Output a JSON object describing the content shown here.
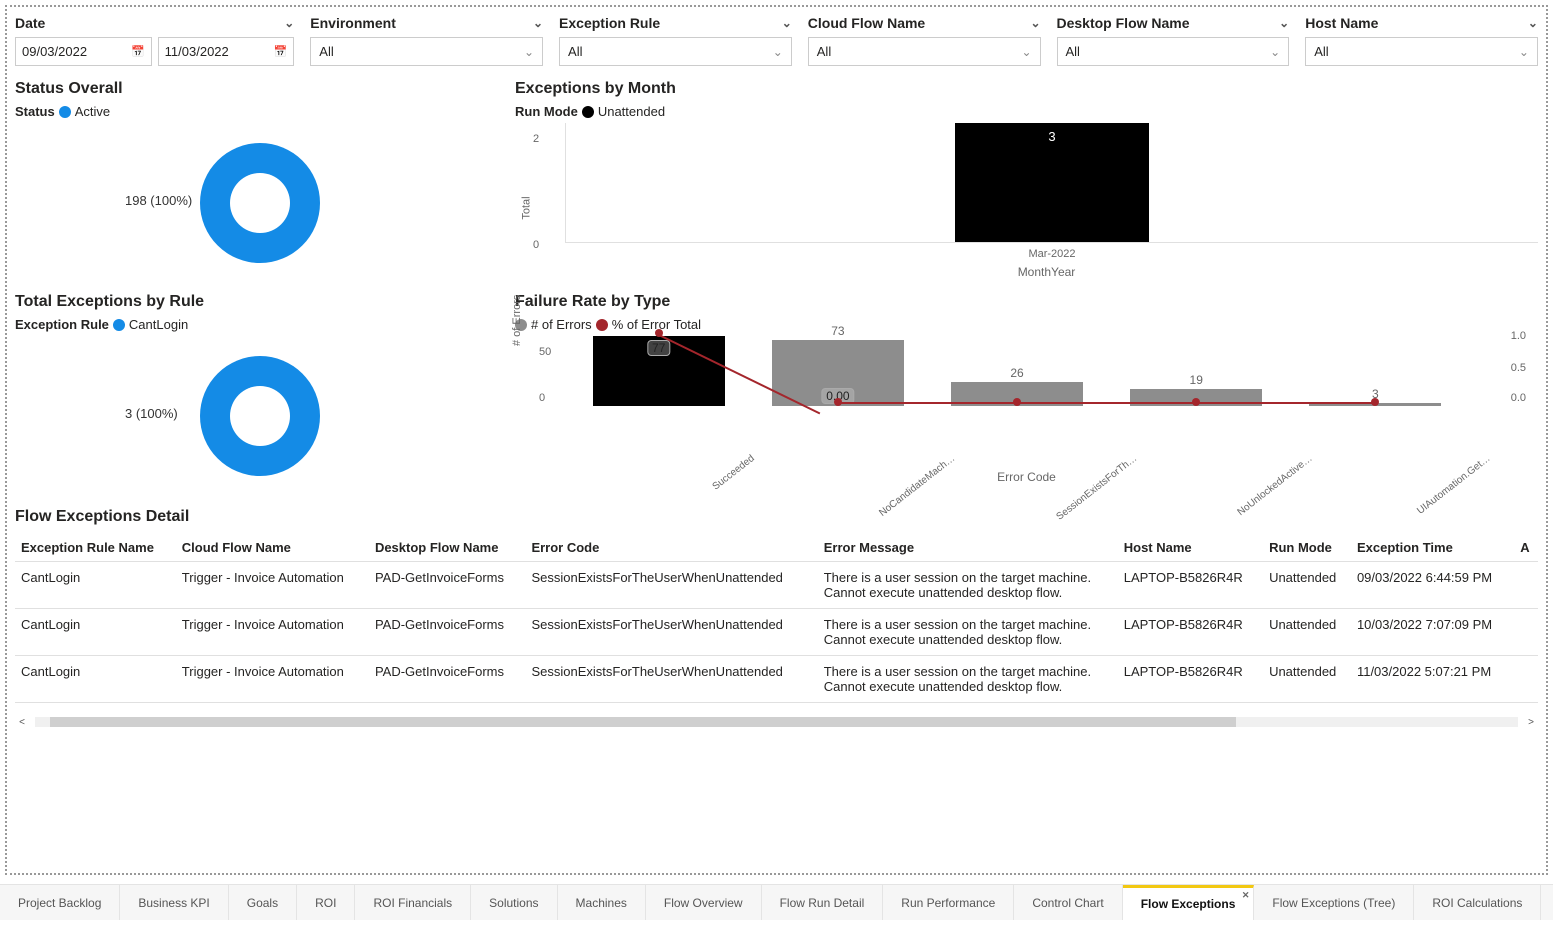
{
  "filters": {
    "date_label": "Date",
    "date_from": "09/03/2022",
    "date_to": "11/03/2022",
    "environment_label": "Environment",
    "environment_value": "All",
    "exception_rule_label": "Exception Rule",
    "exception_rule_value": "All",
    "cloud_flow_label": "Cloud Flow Name",
    "cloud_flow_value": "All",
    "desktop_flow_label": "Desktop Flow Name",
    "desktop_flow_value": "All",
    "host_name_label": "Host Name",
    "host_name_value": "All"
  },
  "status_overall": {
    "title": "Status Overall",
    "legend_label": "Status",
    "legend_item": "Active",
    "label": "198 (100%)"
  },
  "exceptions_by_month": {
    "title": "Exceptions by Month",
    "legend_label": "Run Mode",
    "legend_item": "Unattended",
    "y_label": "Total",
    "y_tick_top": "2",
    "y_tick_bottom": "0",
    "bar_value": "3",
    "category": "Mar-2022",
    "x_label": "MonthYear"
  },
  "exceptions_by_rule": {
    "title": "Total Exceptions by Rule",
    "legend_label": "Exception Rule",
    "legend_item": "CantLogin",
    "label": "3 (100%)"
  },
  "failure_rate": {
    "title": "Failure Rate by Type",
    "legend1": "# of Errors",
    "legend2": "% of Error Total",
    "y_left_label": "# of Errors",
    "y_left_tick_top": "50",
    "y_left_tick_bottom": "0",
    "y_right_tick_top": "1.0",
    "y_right_tick_mid": "0.5",
    "y_right_tick_bottom": "0.0",
    "x_label": "Error Code",
    "bars": {
      "b0": {
        "label": "77",
        "ann": "77",
        "cat": "Succeeded"
      },
      "b1": {
        "label": "73",
        "ann": "0.00",
        "cat": "NoCandidateMach…"
      },
      "b2": {
        "label": "26",
        "cat": "SessionExistsForTh…"
      },
      "b3": {
        "label": "19",
        "cat": "NoUnlockedActive…"
      },
      "b4": {
        "label": "3",
        "cat": "UIAutomation.Get…"
      }
    }
  },
  "detail": {
    "title": "Flow Exceptions Detail",
    "headers": {
      "h0": "Exception Rule Name",
      "h1": "Cloud Flow Name",
      "h2": "Desktop Flow Name",
      "h3": "Error Code",
      "h4": "Error Message",
      "h5": "Host Name",
      "h6": "Run Mode",
      "h7": "Exception Time",
      "h8": "A"
    },
    "rows": {
      "r0": {
        "c0": "CantLogin",
        "c1": "Trigger - Invoice Automation",
        "c2": "PAD-GetInvoiceForms",
        "c3": "SessionExistsForTheUserWhenUnattended",
        "c4": "There is a user session on the target machine. Cannot execute unattended desktop flow.",
        "c5": "LAPTOP-B5826R4R",
        "c6": "Unattended",
        "c7": "09/03/2022 6:44:59 PM"
      },
      "r1": {
        "c0": "CantLogin",
        "c1": "Trigger - Invoice Automation",
        "c2": "PAD-GetInvoiceForms",
        "c3": "SessionExistsForTheUserWhenUnattended",
        "c4": "There is a user session on the target machine. Cannot execute unattended desktop flow.",
        "c5": "LAPTOP-B5826R4R",
        "c6": "Unattended",
        "c7": "10/03/2022 7:07:09 PM"
      },
      "r2": {
        "c0": "CantLogin",
        "c1": "Trigger - Invoice Automation",
        "c2": "PAD-GetInvoiceForms",
        "c3": "SessionExistsForTheUserWhenUnattended",
        "c4": "There is a user session on the target machine. Cannot execute unattended desktop flow.",
        "c5": "LAPTOP-B5826R4R",
        "c6": "Unattended",
        "c7": "11/03/2022 5:07:21 PM"
      }
    }
  },
  "tabs": {
    "t0": "Project Backlog",
    "t1": "Business KPI",
    "t2": "Goals",
    "t3": "ROI",
    "t4": "ROI Financials",
    "t5": "Solutions",
    "t6": "Machines",
    "t7": "Flow Overview",
    "t8": "Flow Run Detail",
    "t9": "Run Performance",
    "t10": "Control Chart",
    "t11": "Flow Exceptions",
    "t12": "Flow Exceptions (Tree)",
    "t13": "ROI Calculations"
  },
  "chart_data": [
    {
      "type": "pie",
      "title": "Status Overall",
      "categories": [
        "Active"
      ],
      "values": [
        198
      ],
      "series_name": "Status"
    },
    {
      "type": "bar",
      "title": "Exceptions by Month",
      "categories": [
        "Mar-2022"
      ],
      "values": [
        3
      ],
      "xlabel": "MonthYear",
      "ylabel": "Total",
      "ylim": [
        0,
        3
      ],
      "series_name": "Unattended"
    },
    {
      "type": "pie",
      "title": "Total Exceptions by Rule",
      "categories": [
        "CantLogin"
      ],
      "values": [
        3
      ],
      "series_name": "Exception Rule"
    },
    {
      "type": "bar",
      "title": "Failure Rate by Type",
      "categories": [
        "Succeeded",
        "NoCandidateMach…",
        "SessionExistsForTh…",
        "NoUnlockedActive…",
        "UIAutomation.Get…"
      ],
      "series": [
        {
          "name": "# of Errors",
          "values": [
            77,
            73,
            26,
            19,
            3
          ]
        },
        {
          "name": "% of Error Total",
          "values": [
            1.0,
            0.0,
            0.0,
            0.0,
            0.0
          ]
        }
      ],
      "xlabel": "Error Code",
      "ylabel": "# of Errors",
      "ylim": [
        0,
        77
      ],
      "y2lim": [
        0.0,
        1.0
      ]
    }
  ]
}
